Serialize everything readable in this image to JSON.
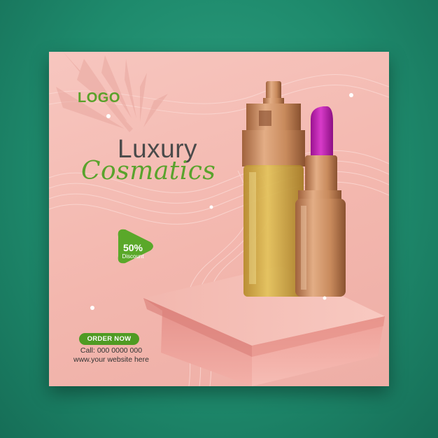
{
  "brand": {
    "logo_text": "LOGO"
  },
  "headline": {
    "line1": "Luxury",
    "line2": "Cosmatics"
  },
  "offer": {
    "value": "50%",
    "label": "Discount"
  },
  "cta": {
    "label": "ORDER NOW"
  },
  "contact": {
    "phone": "Call: 000 0000 000",
    "website": "www.your website here"
  },
  "colors": {
    "background": "#1e8a6c",
    "card": "#f3b7ae",
    "accent_green": "#59a32c",
    "lipstick": "#c01fb4",
    "gold": "#c88a5c"
  }
}
